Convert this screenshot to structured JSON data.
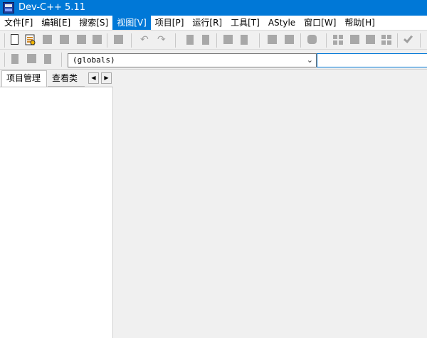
{
  "window": {
    "title": "Dev-C++ 5.11",
    "app_icon": "devcpp-icon"
  },
  "menu": [
    {
      "label": "文件[F]"
    },
    {
      "label": "编辑[E]"
    },
    {
      "label": "搜索[S]"
    },
    {
      "label": "视图[V]"
    },
    {
      "label": "项目[P]"
    },
    {
      "label": "运行[R]"
    },
    {
      "label": "工具[T]"
    },
    {
      "label": "AStyle"
    },
    {
      "label": "窗口[W]"
    },
    {
      "label": "帮助[H]"
    }
  ],
  "menu_active_index": 3,
  "scope_combo": {
    "value": "(globals)"
  },
  "symbol_combo": {
    "value": ""
  },
  "panel_tabs": [
    {
      "label": "项目管理"
    },
    {
      "label": "查看类"
    }
  ],
  "colors": {
    "titlebar": "#0078d7",
    "menu_highlight": "#0078d7",
    "disabled_icon": "#a8a8a8"
  }
}
